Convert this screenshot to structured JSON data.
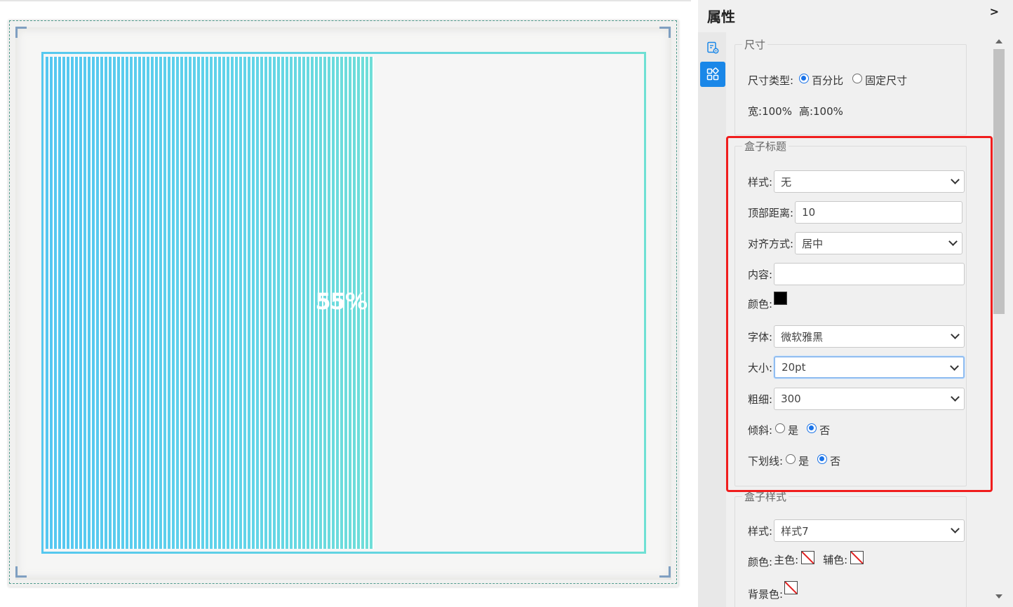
{
  "preview": {
    "progress_fraction": 0.55,
    "progress_label": "55%"
  },
  "panel": {
    "title": "属性",
    "collapse_label": ">",
    "tabs": [
      {
        "icon": "settings-document-icon"
      },
      {
        "icon": "components-icon"
      }
    ]
  },
  "size_section": {
    "legend": "尺寸",
    "type_label": "尺寸类型:",
    "options": [
      "百分比",
      "固定尺寸"
    ],
    "selected": "百分比",
    "width_label": "宽:",
    "width_value": "100%",
    "height_label": "高:",
    "height_value": "100%"
  },
  "box_title_section": {
    "legend": "盒子标题",
    "style_label": "样式:",
    "style_value": "无",
    "top_label": "顶部距离:",
    "top_value": "10",
    "align_label": "对齐方式:",
    "align_value": "居中",
    "content_label": "内容:",
    "content_value": "",
    "color_label": "颜色:",
    "color_value": "#000000",
    "font_label": "字体:",
    "font_value": "微软雅黑",
    "size_label": "大小:",
    "size_value": "20pt",
    "weight_label": "粗细:",
    "weight_value": "300",
    "italic_label": "倾斜:",
    "italic_options": [
      "是",
      "否"
    ],
    "italic_selected": "否",
    "underline_label": "下划线:",
    "underline_options": [
      "是",
      "否"
    ],
    "underline_selected": "否"
  },
  "box_style_section": {
    "legend": "盒子样式",
    "style_label": "样式:",
    "style_value": "样式7",
    "color_label": "颜色:",
    "main_color_label": "主色:",
    "aux_color_label": "辅色:",
    "bg_color_label": "背景色:"
  },
  "colors": {
    "accent": "#1a87e8",
    "highlight": "#f01d1d",
    "progress_start": "#55c7f1",
    "progress_end": "#6fded8"
  }
}
